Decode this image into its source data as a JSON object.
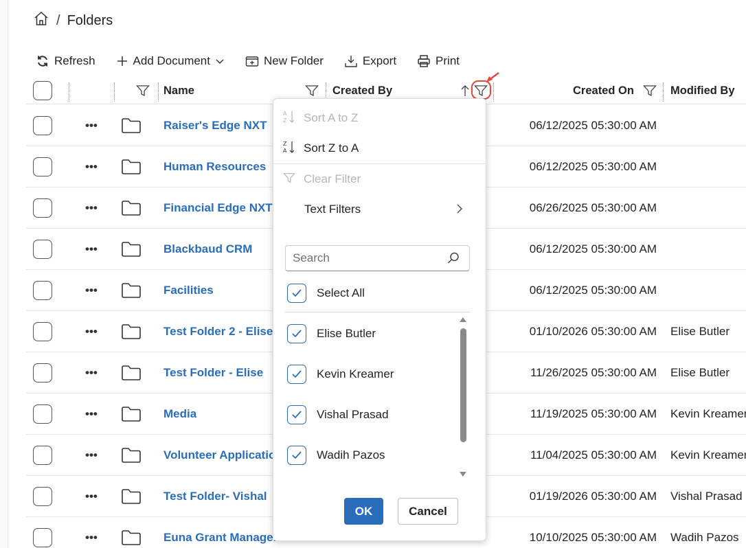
{
  "breadcrumb": {
    "title": "Folders",
    "separator": "/"
  },
  "toolbar": {
    "refresh": "Refresh",
    "add_document": "Add Document",
    "new_folder": "New Folder",
    "export": "Export",
    "print": "Print"
  },
  "columns": {
    "name": "Name",
    "created_by": "Created By",
    "created_on": "Created On",
    "modified_by": "Modified By"
  },
  "rows": [
    {
      "name": "Raiser's Edge NXT",
      "created_on": "06/12/2025 05:30:00 AM",
      "modified_by": ""
    },
    {
      "name": "Human Resources",
      "created_on": "06/12/2025 05:30:00 AM",
      "modified_by": ""
    },
    {
      "name": "Financial Edge NXT",
      "created_on": "06/26/2025 05:30:00 AM",
      "modified_by": ""
    },
    {
      "name": "Blackbaud CRM",
      "created_on": "06/12/2025 05:30:00 AM",
      "modified_by": ""
    },
    {
      "name": "Facilities",
      "created_on": "06/12/2025 05:30:00 AM",
      "modified_by": ""
    },
    {
      "name": "Test Folder 2 - Elise",
      "created_on": "01/10/2026 05:30:00 AM",
      "modified_by": "Elise Butler"
    },
    {
      "name": "Test Folder - Elise",
      "created_on": "11/26/2025 05:30:00 AM",
      "modified_by": "Elise Butler"
    },
    {
      "name": "Media",
      "created_on": "11/19/2025 05:30:00 AM",
      "modified_by": "Kevin Kreamer"
    },
    {
      "name": "Volunteer Applications",
      "created_on": "11/04/2025 05:30:00 AM",
      "modified_by": "Kevin Kreamer"
    },
    {
      "name": "Test Folder- Vishal",
      "created_on": "01/19/2026 05:30:00 AM",
      "modified_by": "Vishal Prasad"
    },
    {
      "name": "Euna Grant Management",
      "created_on": "10/10/2025 05:30:00 AM",
      "modified_by": "Wadih Pazos"
    }
  ],
  "filter_menu": {
    "sort_asc": "Sort A to Z",
    "sort_desc": "Sort Z to A",
    "clear_filter": "Clear Filter",
    "text_filters": "Text Filters",
    "search_placeholder": "Search",
    "select_all": "Select All",
    "options": [
      "Elise Butler",
      "Kevin Kreamer",
      "Vishal Prasad",
      "Wadih Pazos"
    ],
    "ok": "OK",
    "cancel": "Cancel"
  },
  "colors": {
    "accent": "#2a6ebb",
    "highlight": "#e04a3a"
  }
}
